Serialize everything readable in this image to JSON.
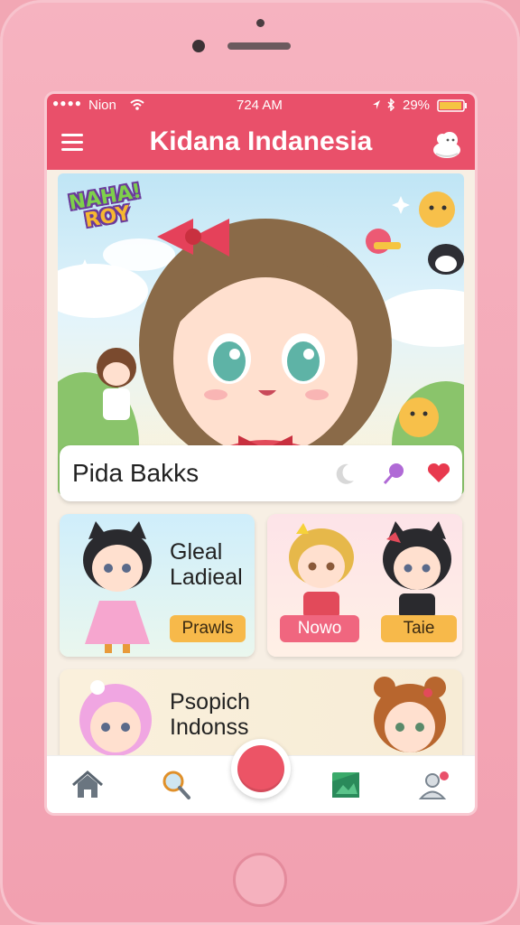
{
  "status": {
    "carrier": "Nion",
    "time": "724 AM",
    "battery": "29%",
    "signal_dots": "●●●●"
  },
  "app": {
    "title": "Kidana Indanesia"
  },
  "hero": {
    "badge_line1": "NAHA!",
    "badge_line2": "ROY",
    "card_title": "Pida Bakks"
  },
  "cards": [
    {
      "title_line1": "Gleal",
      "title_line2": "Ladieal",
      "button": "Prawls"
    },
    {
      "left_button": "Nowo",
      "right_button": "Taie"
    },
    {
      "title_line1": "Psopich",
      "title_line2": "Indonss"
    }
  ],
  "icons": {
    "menu": "hamburger-menu-icon",
    "profile": "cartoon-avatar-icon",
    "card_actions": [
      "moon-icon",
      "lollipop-icon",
      "heart-icon"
    ],
    "nav": [
      "home-icon",
      "search-icon",
      "record-icon",
      "image-icon",
      "profile-icon"
    ]
  },
  "colors": {
    "accent": "#e9506a",
    "phone_body": "#f2a7b4",
    "button_orange": "#f7b94a",
    "button_pink": "#f0667f"
  }
}
